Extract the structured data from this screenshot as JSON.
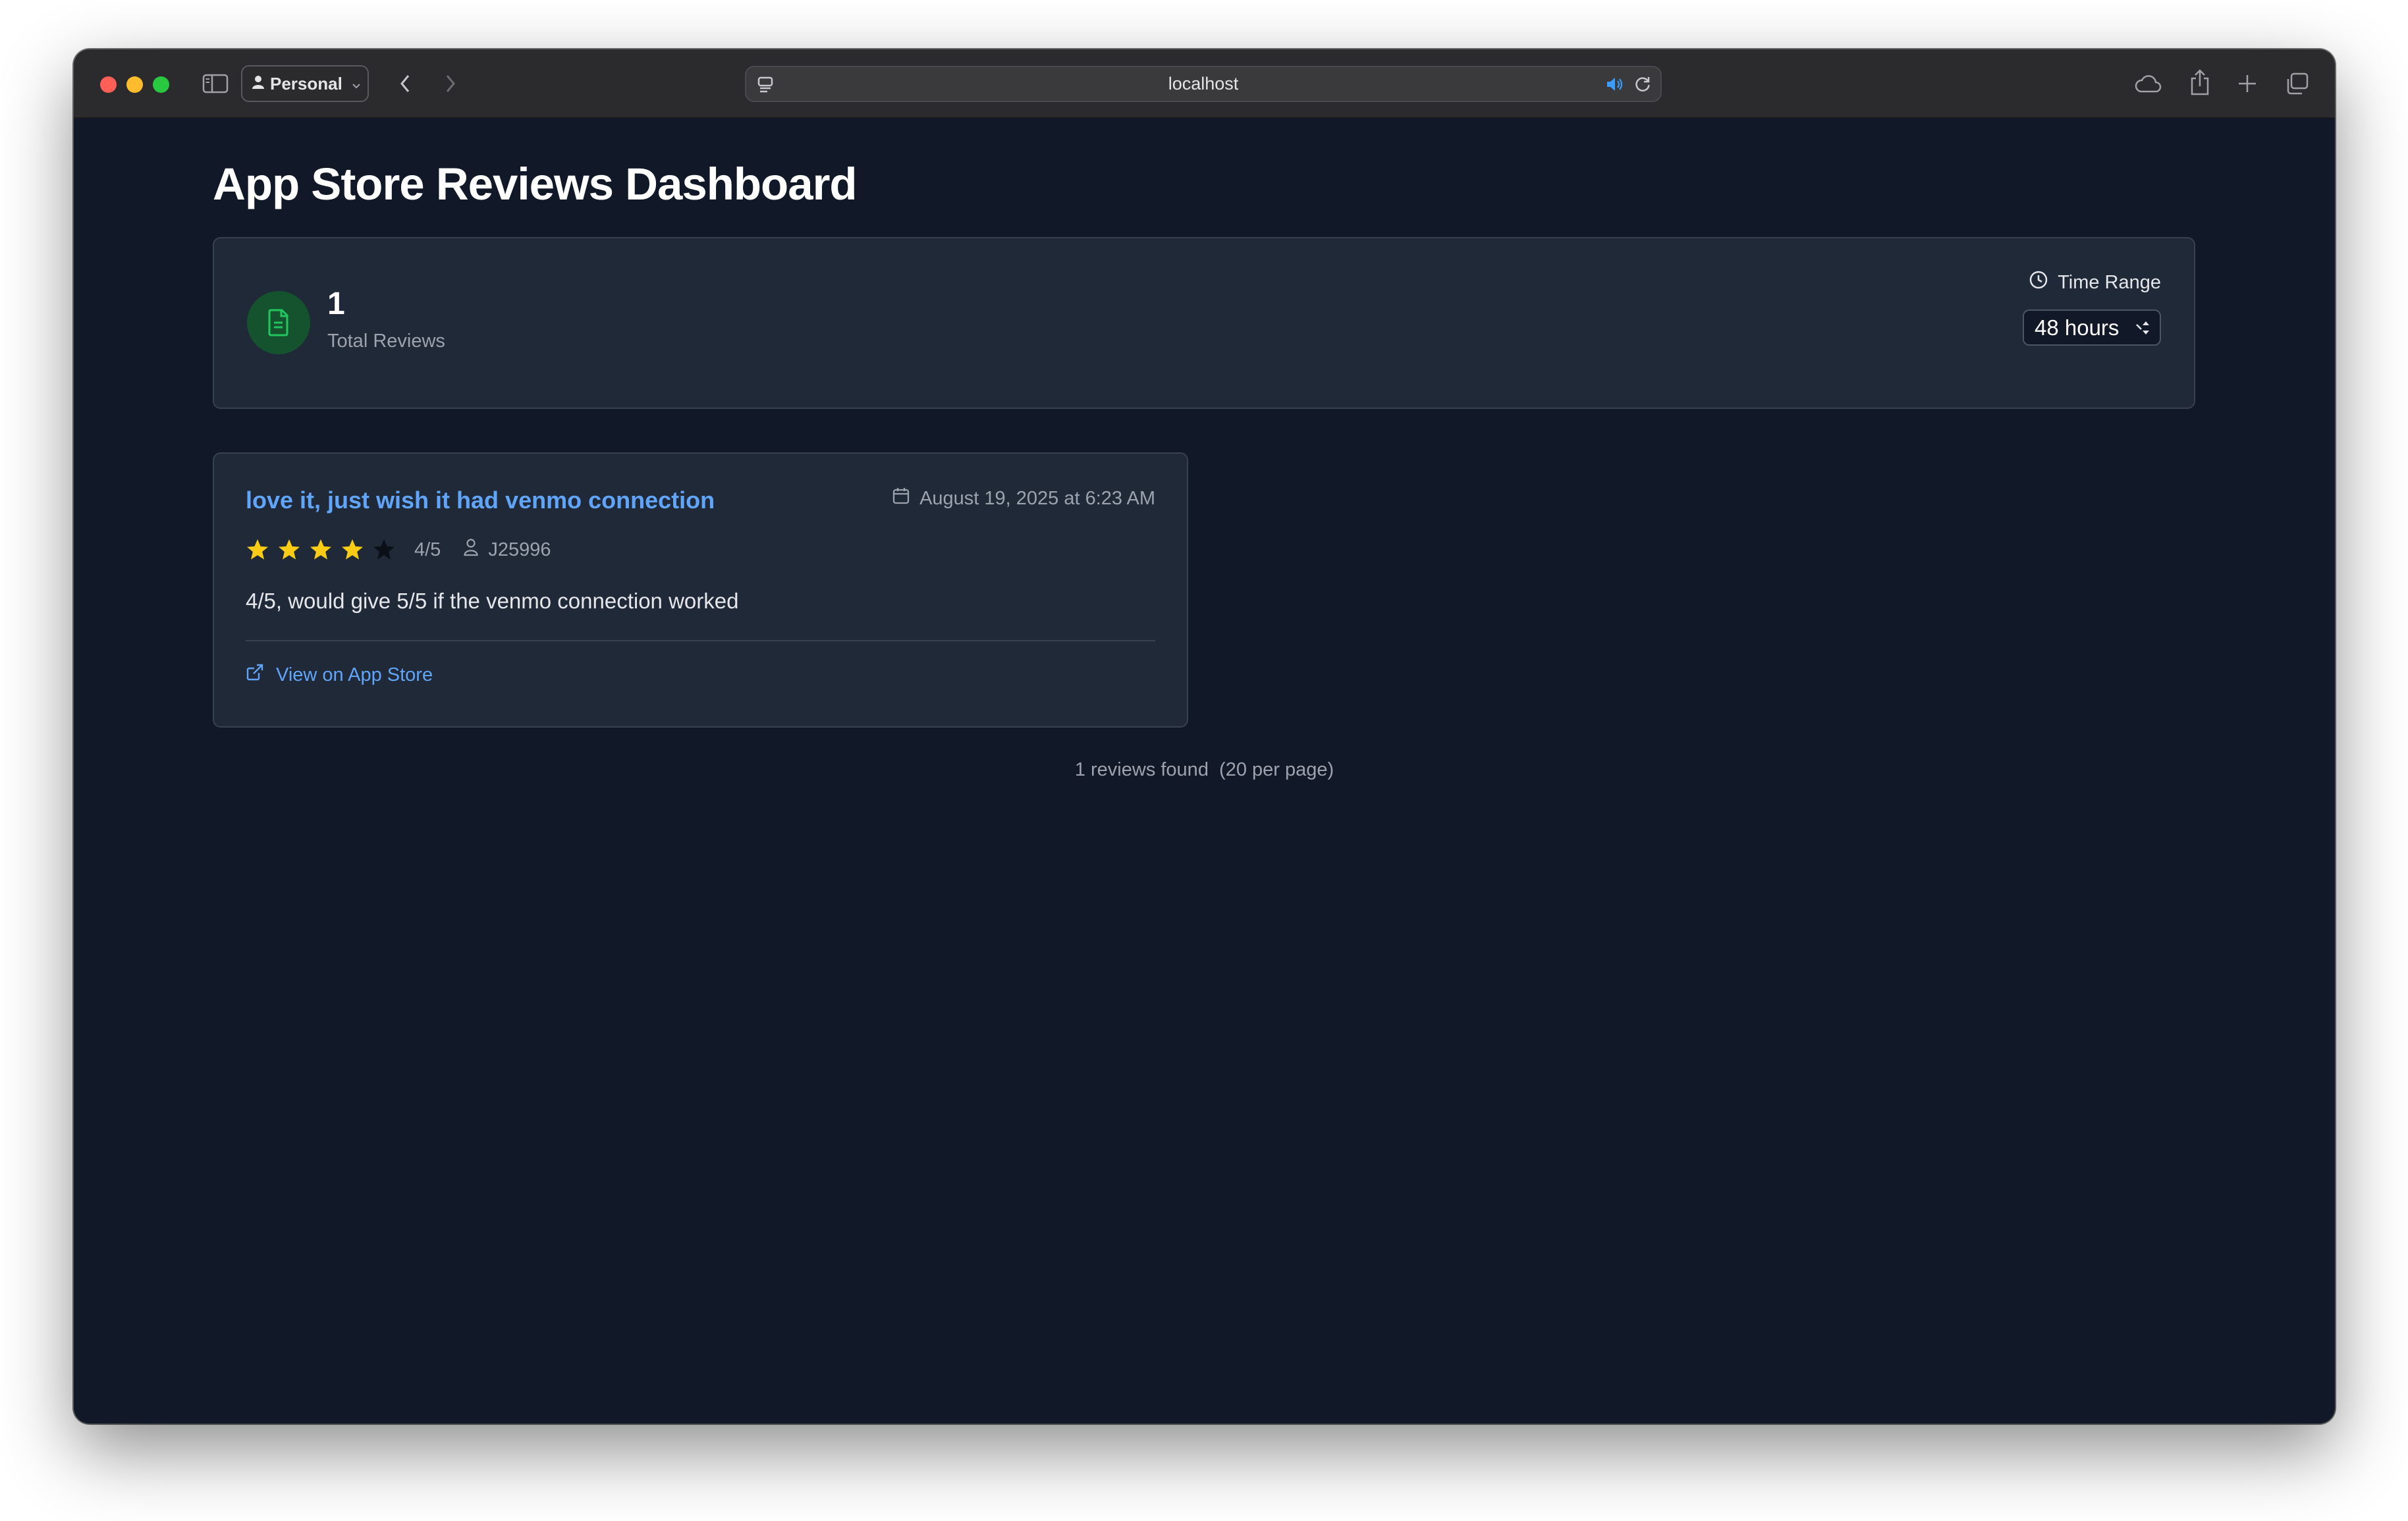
{
  "browser": {
    "profile_label": "Personal",
    "url": "localhost"
  },
  "page": {
    "title": "App Store Reviews Dashboard"
  },
  "stats": {
    "total_reviews_value": "1",
    "total_reviews_label": "Total Reviews",
    "time_range_label": "Time Range",
    "time_range_selected": "48 hours"
  },
  "reviews": [
    {
      "title": "love it, just wish it had venmo connection",
      "date": "August 19, 2025 at 6:23 AM",
      "rating": 4,
      "rating_max": 5,
      "rating_text": "4/5",
      "author": "J25996",
      "body": "4/5, would give 5/5 if the venmo connection worked",
      "link_label": "View on App Store"
    }
  ],
  "footer": {
    "count_text": "1 reviews found  (20 per page)"
  },
  "colors": {
    "background": "#111827",
    "card": "#1f2937",
    "accent_blue": "#60a5fa",
    "star_filled": "#facc15",
    "star_empty": "#0b0f17",
    "icon_green": "#22c55e"
  },
  "icons": {
    "sidebar_toggle": "sidebar-icon",
    "profile": "person-icon",
    "back": "chevron-left-icon",
    "forward": "chevron-right-icon",
    "page_menu": "page-menu-icon",
    "audio": "speaker-icon",
    "reload": "reload-icon",
    "icloud": "cloud-icon",
    "share": "share-icon",
    "new_tab": "plus-icon",
    "tabs": "tabs-overview-icon",
    "stat": "document-icon",
    "time": "clock-icon",
    "date": "calendar-icon",
    "author": "user-icon",
    "external": "external-link-icon"
  }
}
